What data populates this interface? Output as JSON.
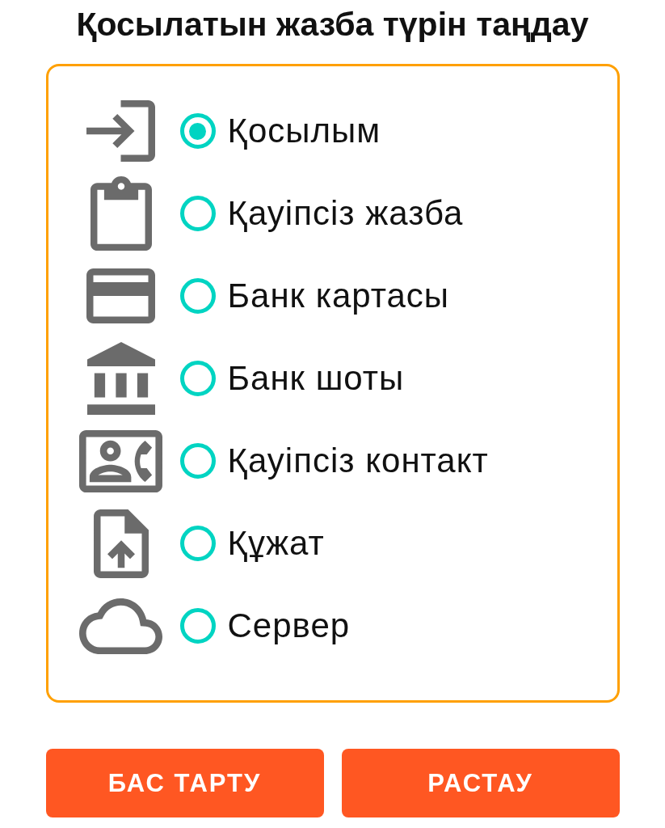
{
  "title": "Қосылатын жазба түрін таңдау",
  "options": [
    {
      "label": "Қосылым",
      "selected": true
    },
    {
      "label": "Қауіпсіз жазба",
      "selected": false
    },
    {
      "label": "Банк картасы",
      "selected": false
    },
    {
      "label": "Банк шоты",
      "selected": false
    },
    {
      "label": "Қауіпсіз контакт",
      "selected": false
    },
    {
      "label": "Құжат",
      "selected": false
    },
    {
      "label": "Сервер",
      "selected": false
    }
  ],
  "buttons": [
    "БАС ТАРТУ",
    "РАСТАУ"
  ]
}
